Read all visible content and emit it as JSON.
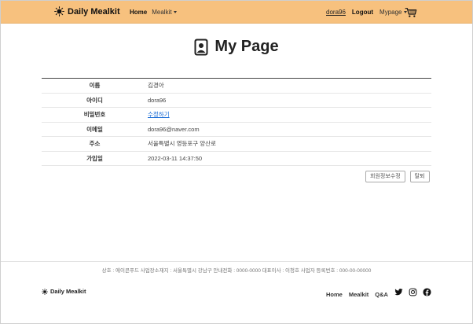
{
  "nav": {
    "brand": "Daily Mealkit",
    "home": "Home",
    "mealkit": "Mealkit",
    "user": "dora96",
    "logout": "Logout",
    "mypage": "Mypage",
    "brand_icon": "sun-icon",
    "cart_icon": "cart-icon"
  },
  "page": {
    "title": "My Page",
    "title_icon": "user-badge-icon"
  },
  "info": {
    "rows": [
      {
        "label": "이름",
        "value": "김경아"
      },
      {
        "label": "아이디",
        "value": "dora96"
      },
      {
        "label": "비밀번호",
        "value": "수정하기"
      },
      {
        "label": "이메일",
        "value": "dora96@naver.com"
      },
      {
        "label": "주소",
        "value": "서울특별시 영등포구 양산로"
      },
      {
        "label": "가입일",
        "value": "2022-03-11 14:37:50"
      }
    ]
  },
  "actions": {
    "edit": "회원정보수정",
    "withdraw": "탈퇴"
  },
  "footer": {
    "info": "상호 : 에이콘푸드    사업장소재지 : 서울특별시 강남구    안내전화 : 0000-0000    대표이사 : 이청호    사업자 등록번호 : 000-00-00000",
    "brand": "Daily Mealkit",
    "links": [
      "Home",
      "Mealkit",
      "Q&A"
    ],
    "social_icons": [
      "twitter-icon",
      "instagram-icon",
      "facebook-icon"
    ]
  },
  "colors": {
    "navbar": "#f7c17e",
    "link": "#1a6cd6"
  }
}
